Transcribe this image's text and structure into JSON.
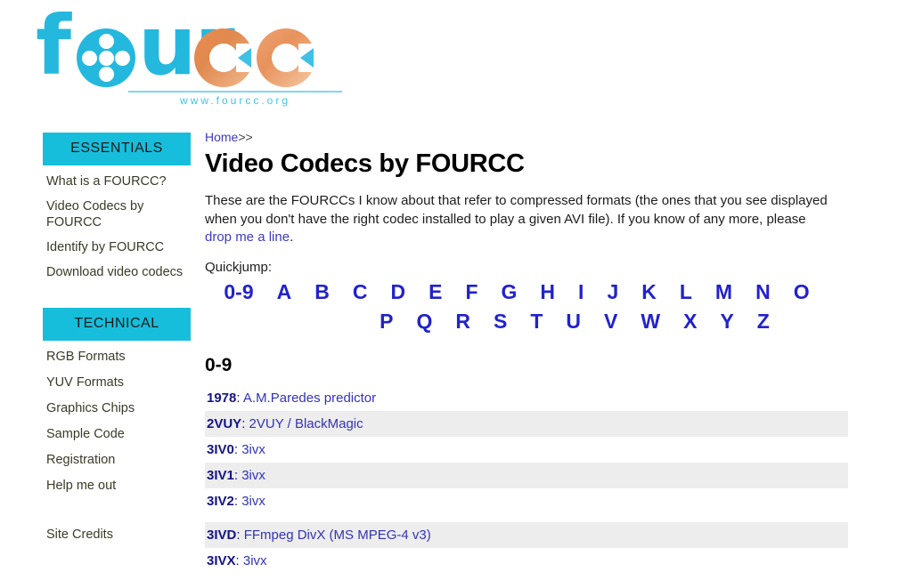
{
  "logo": {
    "text_part1": "f",
    "text_part2": "ur",
    "url": "www.fourcc.org",
    "icon_reel": "film-reel-icon",
    "color_primary": "#24B8DE",
    "color_secondary": "#E98B52"
  },
  "sidebar": {
    "sections": [
      {
        "title": "ESSENTIALS",
        "items": [
          {
            "label": "What is a FOURCC?"
          },
          {
            "label": "Video Codecs by FOURCC"
          },
          {
            "label": "Identify by FOURCC"
          },
          {
            "label": "Download video codecs"
          }
        ]
      },
      {
        "title": "TECHNICAL",
        "items": [
          {
            "label": "RGB Formats"
          },
          {
            "label": "YUV Formats"
          },
          {
            "label": "Graphics Chips"
          },
          {
            "label": "Sample Code"
          },
          {
            "label": "Registration"
          },
          {
            "label": "Help me out"
          }
        ]
      }
    ],
    "credits": {
      "label": "Site Credits"
    },
    "header_color": "#16BEDC"
  },
  "breadcrumb": {
    "home": "Home",
    "separator": ">>"
  },
  "main": {
    "title": "Video Codecs by FOURCC",
    "intro_before": "These are the FOURCCs I know about that refer to compressed formats (the ones that you see displayed when you don't have the right codec installed to play a given AVI file). If you know of any more, please ",
    "intro_link": "drop me a line",
    "intro_after": ".",
    "quickjump_label": "Quickjump:",
    "quickjump_row1": [
      "0-9",
      "A",
      "B",
      "C",
      "D",
      "E",
      "F",
      "G",
      "H",
      "I",
      "J",
      "K",
      "L",
      "M",
      "N",
      "O"
    ],
    "quickjump_row2": [
      "P",
      "Q",
      "R",
      "S",
      "T",
      "U",
      "V",
      "W",
      "X",
      "Y",
      "Z"
    ],
    "section_heading": "0-9",
    "codecs": [
      {
        "code": "1978",
        "desc": "A.M.Paredes predictor",
        "spacer": false
      },
      {
        "code": "2VUY",
        "desc": "2VUY / BlackMagic",
        "spacer": false
      },
      {
        "code": "3IV0",
        "desc": "3ivx",
        "spacer": false
      },
      {
        "code": "3IV1",
        "desc": "3ivx",
        "spacer": false
      },
      {
        "code": "3IV2",
        "desc": "3ivx",
        "spacer": false
      },
      {
        "code": "",
        "desc": "",
        "spacer": true
      },
      {
        "code": "3IVD",
        "desc": "FFmpeg DivX (MS MPEG-4 v3)",
        "spacer": false
      },
      {
        "code": "3IVX",
        "desc": "3ivx",
        "spacer": false
      }
    ],
    "stripe_color": "#EDEDED",
    "link_color": "#3333BB",
    "code_color": "#141486"
  }
}
